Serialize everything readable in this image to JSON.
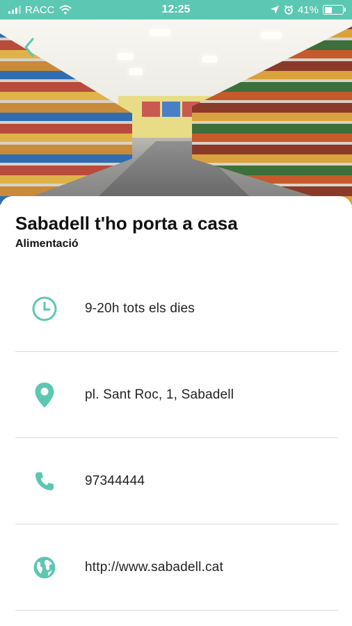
{
  "status_bar": {
    "carrier": "RACC",
    "time": "12:25",
    "battery_percent": "41%",
    "battery_level": 0.41,
    "icons": [
      "signal-icon",
      "wifi-icon",
      "location-arrow-icon",
      "alarm-icon",
      "battery-icon"
    ]
  },
  "hero": {
    "icon": "back-chevron-icon"
  },
  "business": {
    "name": "Sabadell t'ho porta a casa",
    "category": "Alimentació"
  },
  "details": [
    {
      "icon": "clock-icon",
      "text": "9-20h tots els dies"
    },
    {
      "icon": "location-pin-icon",
      "text": "pl. Sant Roc, 1, Sabadell"
    },
    {
      "icon": "phone-icon",
      "text": "97344444"
    },
    {
      "icon": "globe-icon",
      "text": "http://www.sabadell.cat"
    }
  ],
  "colors": {
    "accent": "#5cc7b2",
    "text": "#111111",
    "divider": "#d9d9d9"
  }
}
